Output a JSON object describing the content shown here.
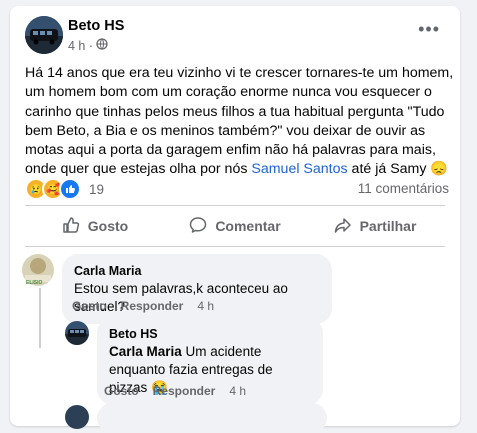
{
  "post": {
    "author": "Beto HS",
    "time": "4 h ·",
    "text_before": "Há 14 anos que era teu vizinho vi te crescer tornares-te um homem, um homem bom com um coração enorme nunca vou esquecer o carinho que tinhas pelos meus filhos  a tua habitual pergunta \"Tudo bem Beto, a Bia e os meninos também?\" vou deixar de ouvir as motas aqui a porta da garagem enfim não há palavras para mais, onde quer que estejas olha por nós ",
    "mention": "Samuel Santos",
    "text_after": " até já Samy 😞",
    "reaction_count": "19",
    "comments_count": "11 comentários",
    "actions": {
      "like": "Gosto",
      "comment": "Comentar",
      "share": "Partilhar"
    }
  },
  "comments": [
    {
      "author": "Carla Maria",
      "text": "Estou sem palavras,k aconteceu ao samuel?",
      "like": "Gosto",
      "reply": "Responder",
      "time": "4 h"
    }
  ],
  "reply": {
    "author": "Beto HS",
    "mention": "Carla Maria",
    "text": " Um acidente enquanto fazia entregas de pizzas 😭",
    "like": "Gosto",
    "reply": "Responder",
    "time": "4 h"
  },
  "avatar_caption": "ELISIO",
  "colors": {
    "link": "#1a65d6",
    "muted": "#65676b",
    "bubble": "#f0f2f5"
  }
}
